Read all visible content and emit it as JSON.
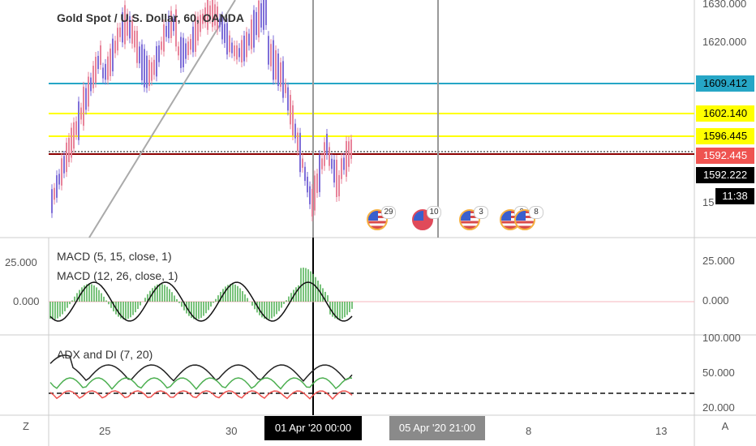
{
  "header": {
    "title": "Gold Spot / U.S. Dollar, 60, OANDA"
  },
  "indicators": {
    "macd1": "MACD (5, 15, close, 1)",
    "macd2": "MACD (12, 26, close, 1)",
    "adx": "ADX and DI (7, 20)"
  },
  "price_axis": {
    "ticks": [
      "1630.000",
      "1620.000"
    ],
    "partial": "15",
    "tags": [
      {
        "label": "1609.412",
        "bg": "#26a6c6",
        "fg": "#000"
      },
      {
        "label": "1602.140",
        "bg": "#ffff00",
        "fg": "#000"
      },
      {
        "label": "1596.445",
        "bg": "#ffff00",
        "fg": "#000"
      },
      {
        "label": "1592.445",
        "bg": "#ef5350",
        "fg": "#fff"
      },
      {
        "label": "1592.222",
        "bg": "#000000",
        "fg": "#fff"
      },
      {
        "label": "11:38",
        "bg": "#000000",
        "fg": "#fff"
      }
    ]
  },
  "macd_axis": {
    "left": [
      "25.000",
      "0.000"
    ],
    "right": [
      "25.000",
      "0.000"
    ]
  },
  "adx_axis": {
    "right": [
      "100.000",
      "50.000",
      "20.000"
    ]
  },
  "time_axis": {
    "labels": [
      "25",
      "30",
      "8",
      "13"
    ],
    "crosshair_time": "01 Apr '20   00:00",
    "second_time": "05 Apr '20   21:00"
  },
  "corner": {
    "left": "Z",
    "right": "A"
  },
  "events": [
    {
      "count": "29",
      "type": "us"
    },
    {
      "count": "10",
      "type": "red"
    },
    {
      "count": "3",
      "type": "us"
    },
    {
      "count": "2",
      "type": "us"
    },
    {
      "count": "8",
      "type": "us"
    }
  ],
  "colors": {
    "bull_candle": "#7e6ed8",
    "bear_candle": "#e8839a",
    "cyan_line": "#26a6c6",
    "yellow_line": "#ffff00",
    "red_line": "#ef5350",
    "macd_hist": "#4caf50",
    "adx_line": "#222222",
    "di_plus": "#4caf50",
    "di_minus": "#ef5350"
  }
}
